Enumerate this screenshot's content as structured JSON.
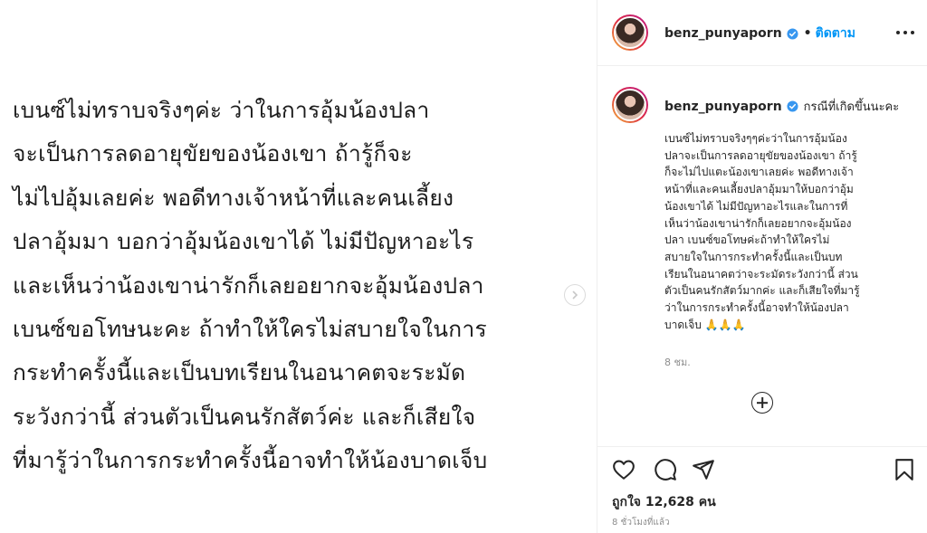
{
  "post": {
    "lines": [
      "เบนซ์ไม่ทราบจริงๆค่ะ ว่าในการอุ้มน้องปลา",
      "จะเป็นการลดอายุขัยของน้องเขา ถ้ารู้ก็จะ",
      "ไม่ไปอุ้มเลยค่ะ พอดีทางเจ้าหน้าที่และคนเลี้ยง",
      "ปลาอุ้มมา บอกว่าอุ้มน้องเขาได้ ไม่มีปัญหาอะไร",
      "และเห็นว่าน้องเขาน่ารักก็เลยอยากจะอุ้มน้องปลา",
      "เบนซ์ขอโทษนะคะ ถ้าทำให้ใครไม่สบายใจในการ",
      "กระทำครั้งนี้และเป็นบทเรียนในอนาคตจะระมัด",
      "ระวังกว่านี้ ส่วนตัวเป็นคนรักสัตว์ค่ะ และก็เสียใจ",
      "ที่มารู้ว่าในการกระทำครั้งนี้อาจทำให้น้องบาดเจ็บ"
    ]
  },
  "header": {
    "username": "benz_punyaporn",
    "dot": "•",
    "follow_label": "ติดตาม"
  },
  "caption": {
    "username": "benz_punyaporn",
    "title": "กรณีที่เกิดขึ้นนะคะ",
    "lines": [
      "เบนซ์ไม่ทราบจริงๆๆค่ะว่าในการอุ้มน้อง",
      "ปลาจะเป็นการลดอายุขัยของน้องเขา ถ้ารู้",
      "ก็จะไม่ไปแตะน้องเขาเลยค่ะ พอดีทางเจ้า",
      "หน้าที่และคนเลี้ยงปลาอุ้มมาให้บอกว่าอุ้ม",
      "น้องเขาได้ ไม่มีปัญหาอะไรและในการที่",
      "เห็นว่าน้องเขาน่ารักก็เลยอยากจะอุ้มน้อง",
      "ปลา เบนซ์ขอโทษค่ะถ้าทำให้ใครไม่",
      "สบายใจในการกระทำครั้งนี้และเป็นบท",
      "เรียนในอนาคตว่าจะระมัดระวังกว่านี้ ส่วน",
      "ตัวเป็นคนรักสัตว์มากค่ะ และก็เสียใจที่มารู้",
      "ว่าในการกระทำครั้งนี้อาจทำให้น้องปลา",
      "บาดเจ็บ 🙏🙏🙏"
    ],
    "time": "8 ชม."
  },
  "footer": {
    "likes": "ถูกใจ 12,628 คน",
    "time": "8 ชั่วโมงที่แล้ว"
  },
  "colors": {
    "accent": "#0095f6",
    "text": "#262626",
    "muted": "#8e8e8e",
    "border": "#efefef"
  },
  "icons": [
    "verified-icon",
    "more-options-icon",
    "add-comment-icon",
    "like-icon",
    "comment-icon",
    "share-icon",
    "save-icon",
    "chevron-right-icon"
  ]
}
